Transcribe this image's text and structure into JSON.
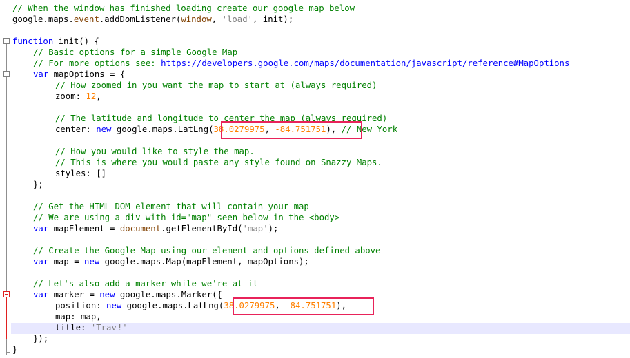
{
  "editor": {
    "lines": {
      "l1": "// When the window has finished loading create our google map below",
      "l2a": "google.maps.",
      "l2b": "event",
      "l2c": ".addDomListener(",
      "l2d": "window",
      "l2e": ", ",
      "l2f": "'load'",
      "l2g": ", init);",
      "l4a": "function",
      "l4b": " init() {",
      "l5": "// Basic options for a simple Google Map",
      "l6a": "// For more options see: ",
      "l6b": "https://developers.google.com/maps/documentation/javascript/reference#MapOptions",
      "l7a": "var",
      "l7b": " mapOptions = {",
      "l8": "// How zoomed in you want the map to start at (always required)",
      "l9a": "zoom: ",
      "l9b": "12",
      "l9c": ",",
      "l11": "// The latitude and longitude to center the map (always required)",
      "l12a": "center: ",
      "l12b": "new",
      "l12c": " google.maps.LatLng(",
      "l12d": "38.0279975",
      "l12e": ", ",
      "l12f": "-84.751751",
      "l12g": "), ",
      "l12h": "// New York",
      "l14": "// How you would like to style the map.",
      "l15": "// This is where you would paste any style found on Snazzy Maps.",
      "l16": "styles: []",
      "l17": "};",
      "l19": "// Get the HTML DOM element that will contain your map",
      "l20": "// We are using a div with id=\"map\" seen below in the <body>",
      "l21a": "var",
      "l21b": " mapElement = ",
      "l21c": "document",
      "l21d": ".getElementById(",
      "l21e": "'map'",
      "l21f": ");",
      "l23": "// Create the Google Map using our element and options defined above",
      "l24a": "var",
      "l24b": " map = ",
      "l24c": "new",
      "l24d": " google.maps.Map(mapElement, mapOptions);",
      "l26": "// Let's also add a marker while we're at it",
      "l27a": "var",
      "l27b": " marker = ",
      "l27c": "new",
      "l27d": " google.maps.Marker({",
      "l28a": "position: ",
      "l28b": "new",
      "l28c": " google.maps.LatLng(",
      "l28d": "38.0279975",
      "l28e": ", ",
      "l28f": "-84.751751",
      "l28g": "),",
      "l29": "map: map,",
      "l30a": "title: ",
      "l30b": "'Trav",
      "l30c": "!'",
      "l31": "});",
      "l32": "}"
    },
    "colors": {
      "comment": "#008000",
      "keyword": "#0000ff",
      "number": "#ff8000",
      "string": "#808080",
      "highlight_box": "#e8235a"
    }
  }
}
